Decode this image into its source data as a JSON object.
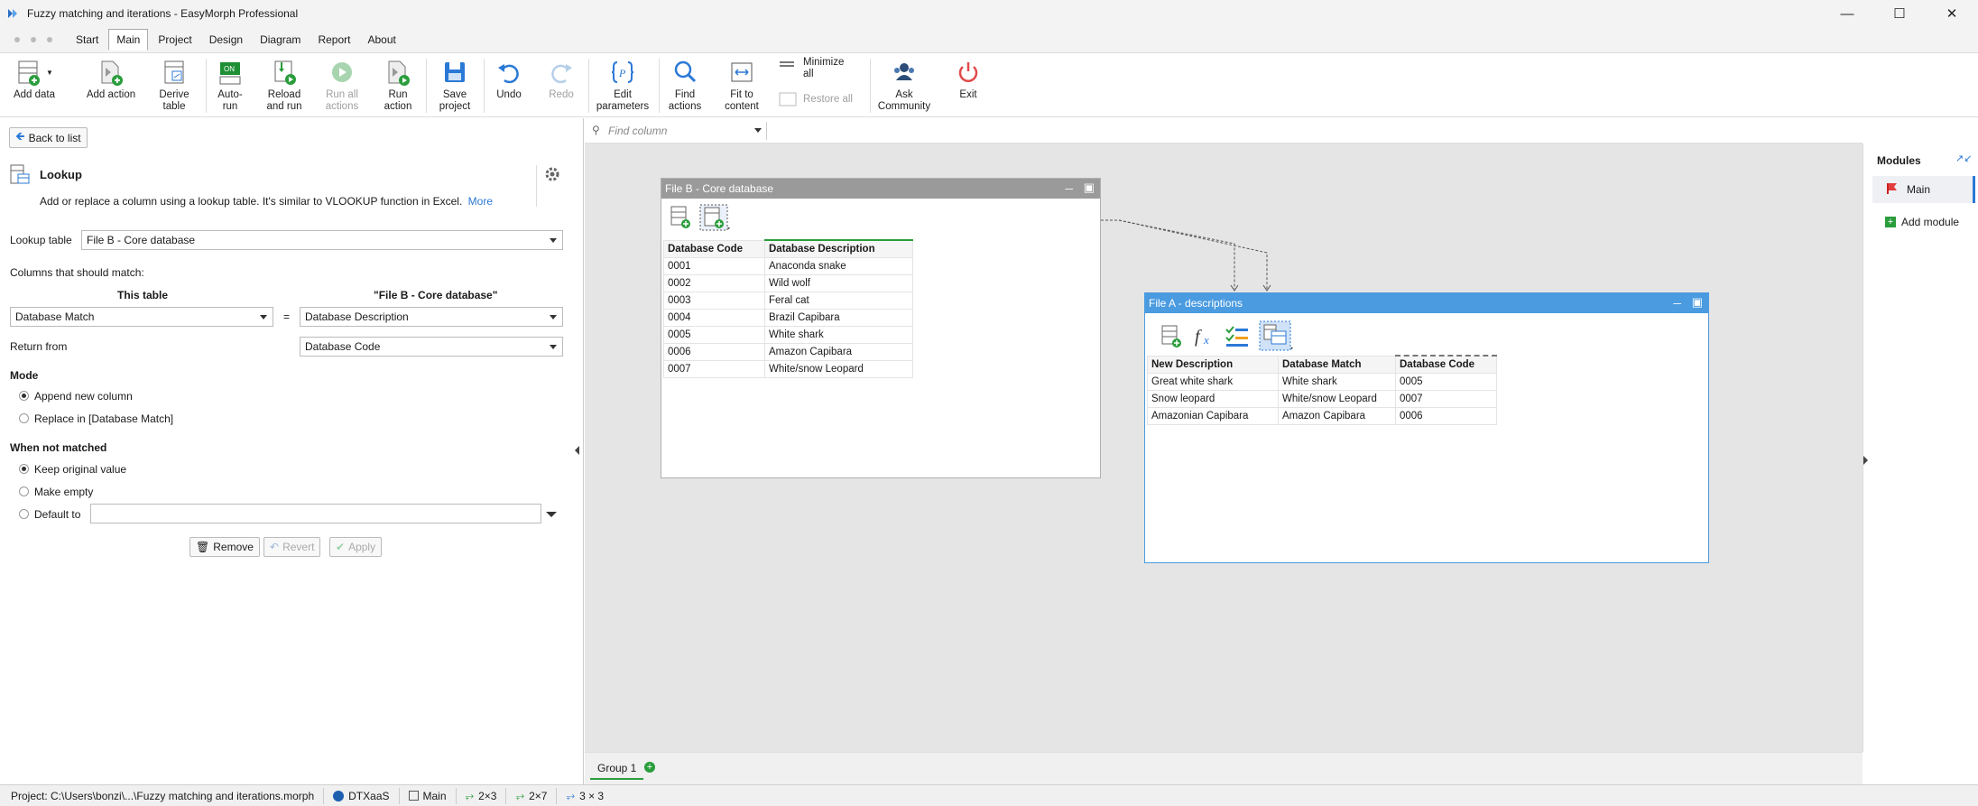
{
  "window": {
    "title": "Fuzzy matching and iterations - EasyMorph Professional"
  },
  "menu": [
    "Start",
    "Main",
    "Project",
    "Design",
    "Diagram",
    "Report",
    "About"
  ],
  "ribbon": {
    "add_data": "Add data",
    "add_action": "Add action",
    "derive_table": [
      "Derive",
      "table"
    ],
    "auto_run": [
      "Auto-",
      "run"
    ],
    "reload_and_run": [
      "Reload",
      "and run"
    ],
    "run_all_actions": [
      "Run all",
      "actions"
    ],
    "run_action": [
      "Run",
      "action"
    ],
    "save_project": [
      "Save",
      "project"
    ],
    "undo": "Undo",
    "redo": "Redo",
    "edit_parameters": [
      "Edit",
      "parameters"
    ],
    "find_actions": [
      "Find",
      "actions"
    ],
    "fit_to_content": [
      "Fit to",
      "content"
    ],
    "minimize_all": [
      "Minimize",
      "all"
    ],
    "restore_all": "Restore all",
    "ask_community": [
      "Ask",
      "Community"
    ],
    "exit": "Exit"
  },
  "left": {
    "back": "Back to list",
    "action_title": "Lookup",
    "description": "Add or replace a column using a lookup table. It's similar to VLOOKUP function in Excel.",
    "more": "More",
    "lookup_table_label": "Lookup table",
    "lookup_table_value": "File B - Core database",
    "columns_match_label": "Columns that should match:",
    "this_table": "This table",
    "other_table": "\"File B - Core database\"",
    "match_left": "Database Match",
    "equals": "=",
    "match_right": "Database Description",
    "return_from_label": "Return from",
    "return_from_value": "Database Code",
    "mode_label": "Mode",
    "mode_append": "Append new column",
    "mode_replace": "Replace in [Database Match]",
    "not_matched_label": "When not matched",
    "nm_keep": "Keep original value",
    "nm_empty": "Make empty",
    "nm_default": "Default to",
    "remove": "Remove",
    "revert": "Revert",
    "apply": "Apply"
  },
  "find_column_placeholder": "Find column",
  "tableB": {
    "title": "File B - Core database",
    "headers": [
      "Database Code",
      "Database Description"
    ],
    "rows": [
      [
        "0001",
        "Anaconda snake"
      ],
      [
        "0002",
        "Wild wolf"
      ],
      [
        "0003",
        "Feral cat"
      ],
      [
        "0004",
        "Brazil Capibara"
      ],
      [
        "0005",
        "White shark"
      ],
      [
        "0006",
        "Amazon Capibara"
      ],
      [
        "0007",
        "White/snow Leopard"
      ]
    ]
  },
  "tableA": {
    "title": "File A - descriptions",
    "headers": [
      "New Description",
      "Database Match",
      "Database Code"
    ],
    "rows": [
      [
        "Great white shark",
        "White shark",
        "0005"
      ],
      [
        "Snow leopard",
        "White/snow Leopard",
        "0007"
      ],
      [
        "Amazonian Capibara",
        "Amazon Capibara",
        "0006"
      ]
    ]
  },
  "modules": {
    "title": "Modules",
    "items": [
      "Main"
    ],
    "add": "Add module"
  },
  "group_tab": "Group 1",
  "status": {
    "project": "Project:  C:\\Users\\bonzi\\...\\Fuzzy matching and iterations.morph",
    "dtxaas": "DTXaaS",
    "module": "Main",
    "s1": "2×3",
    "s2": "2×7",
    "s3": "3 × 3"
  },
  "colors": {
    "accent": "#2b79d6",
    "tableA_header": "#4a9be0",
    "tableB_header": "#9a9a9a",
    "green": "#2a9d3c"
  }
}
